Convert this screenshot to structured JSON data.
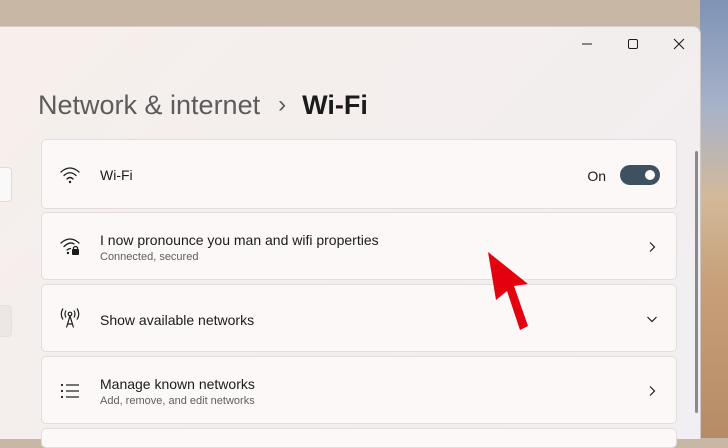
{
  "header": {
    "breadcrumb_parent": "Network & internet",
    "separator": "›",
    "page_title": "Wi-Fi"
  },
  "window_controls": {
    "minimize": "—",
    "maximize": "☐",
    "close": "✕"
  },
  "settings": [
    {
      "title": "Wi-Fi",
      "icon": "wifi-icon",
      "toggle_label": "On",
      "toggle_state": true
    },
    {
      "title": "I now pronounce you man and wifi properties",
      "subtitle": "Connected, secured",
      "icon": "wifi-secured-icon",
      "action": "chevron-right-icon"
    },
    {
      "title": "Show available networks",
      "icon": "antenna-icon",
      "action": "chevron-down-icon"
    },
    {
      "title": "Manage known networks",
      "subtitle": "Add, remove, and edit networks",
      "icon": "list-icon",
      "action": "chevron-right-icon"
    }
  ],
  "colors": {
    "toggle_on": "#3f5060",
    "annotation_arrow": "#e3000f"
  }
}
